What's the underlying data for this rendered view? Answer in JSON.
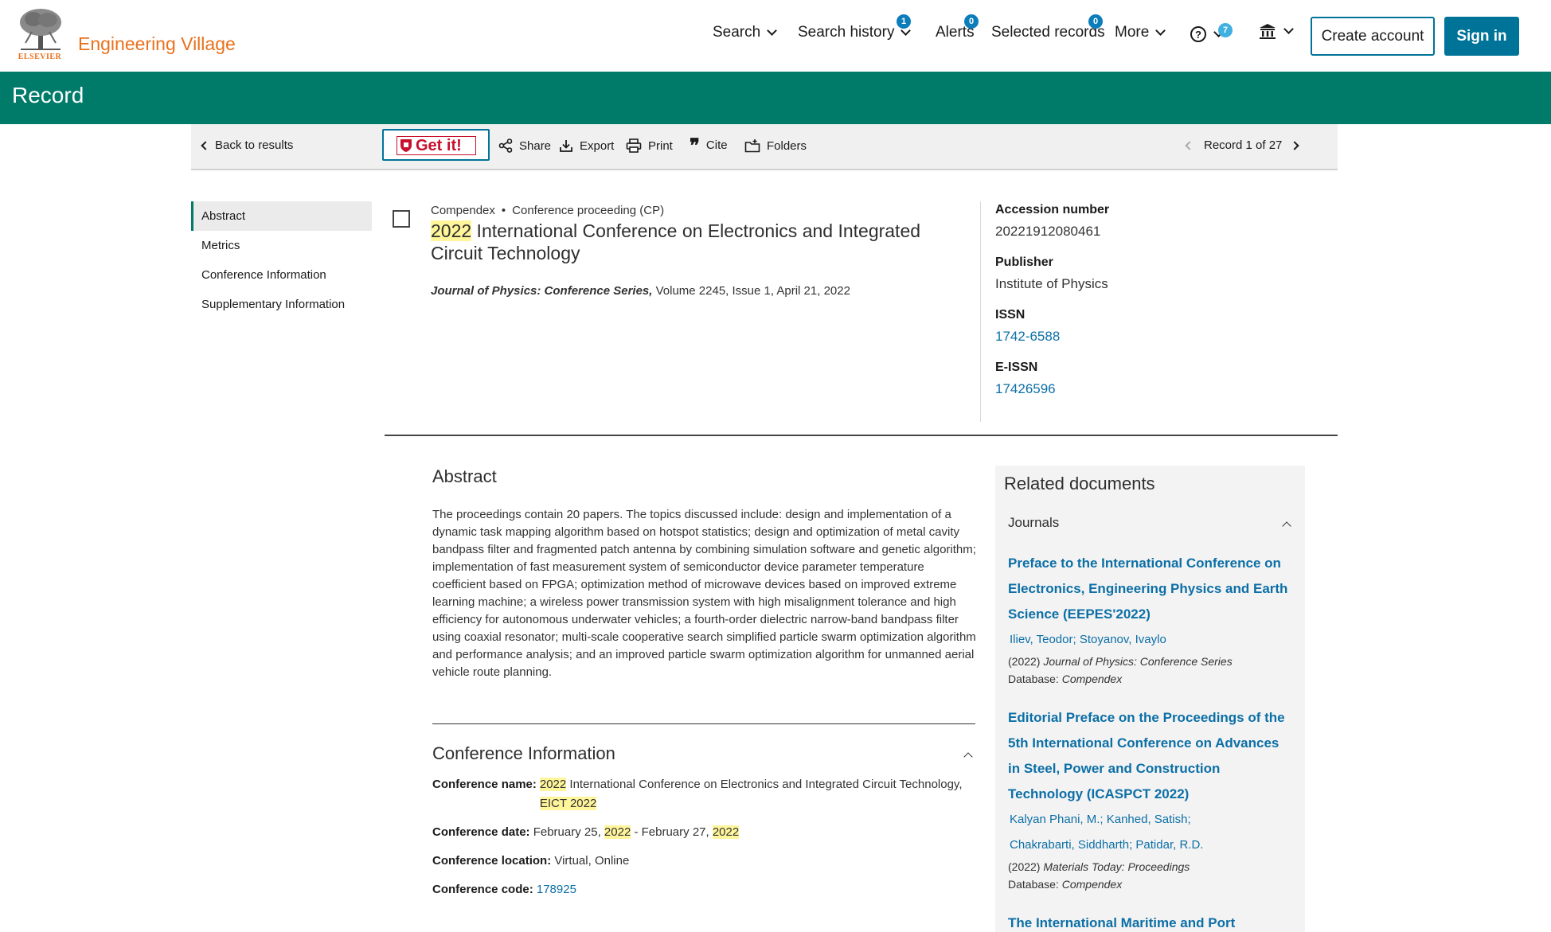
{
  "header": {
    "logo_text": "ELSEVIER",
    "brand": "Engineering Village",
    "nav": {
      "search": "Search",
      "search_history": "Search history",
      "search_history_count": "1",
      "alerts": "Alerts",
      "alerts_count": "0",
      "selected_records": "Selected records",
      "selected_records_count": "0",
      "more": "More",
      "help_count": "7"
    },
    "create_account": "Create account",
    "sign_in": "Sign in",
    "icons": [
      "help-icon",
      "institution-icon",
      "chevron-down-icon"
    ]
  },
  "band": {
    "title": "Record"
  },
  "toolbar": {
    "back": "Back to results",
    "getit": "Get it!",
    "share": "Share",
    "export": "Export",
    "print": "Print",
    "cite": "Cite",
    "folders": "Folders",
    "record_position": "Record 1 of 27"
  },
  "leftnav": {
    "items": [
      "Abstract",
      "Metrics",
      "Conference Information",
      "Supplementary Information"
    ],
    "active": "Abstract"
  },
  "record": {
    "database": "Compendex",
    "bullet": "•",
    "doc_type": "Conference proceeding (CP)",
    "title_year": "2022",
    "title_rest": " International Conference on Electronics and Integrated Circuit Technology",
    "source_journal": "Journal of Physics: Conference Series,",
    "source_rest": " Volume 2245, Issue 1, April 21, 2022"
  },
  "side_meta": {
    "accession_label": "Accession number",
    "accession_value": "20221912080461",
    "publisher_label": "Publisher",
    "publisher_value": "Institute of Physics",
    "issn_label": "ISSN",
    "issn_value": "1742-6588",
    "eissn_label": "E-ISSN",
    "eissn_value": "17426596"
  },
  "abstract": {
    "heading": "Abstract",
    "text": "The proceedings contain 20 papers. The topics discussed include: design and implementation of a dynamic task mapping algorithm based on hotspot statistics; design and optimization of metal cavity bandpass filter and fragmented patch antenna by combining simulation software and genetic algorithm; implementation of fast measurement system of semiconductor device parameter temperature coefficient based on FPGA; optimization method of microwave devices based on improved extreme learning machine; a wireless power transmission system with high misalignment tolerance and high efficiency for autonomous underwater vehicles; a fourth-order dielectric narrow-band bandpass filter using coaxial resonator; multi-scale cooperative search simplified particle swarm optimization algorithm and performance analysis; and an improved particle swarm optimization algorithm for unmanned aerial vehicle route planning."
  },
  "conference": {
    "heading": "Conference Information",
    "name_label": "Conference name:",
    "name_year": "2022",
    "name_rest": " International Conference on Electronics and Integrated Circuit Technology,",
    "name_acronym": "EICT 2022",
    "date_label": "Conference date:",
    "date_start": "February 25, ",
    "date_start_year": "2022",
    "date_sep": " - February 27, ",
    "date_end_year": "2022",
    "location_label": "Conference location:",
    "location_value": "Virtual, Online",
    "code_label": "Conference code:",
    "code_value": "178925"
  },
  "related": {
    "heading": "Related documents",
    "section": "Journals",
    "items": [
      {
        "title": "Preface to the International Conference on Electronics, Engineering Physics and Earth Science (EEPES'2022)",
        "authors": [
          "Iliev, Teodor;",
          "Stoyanov, Ivaylo"
        ],
        "year": "(2022) ",
        "journal": "Journal of Physics: Conference Series",
        "db_label": "Database: ",
        "db": "Compendex"
      },
      {
        "title": "Editorial Preface on the Proceedings of the 5th International Conference on Advances in Steel, Power and Construction Technology (ICASPCT 2022)",
        "authors": [
          "Kalyan Phani, M.;",
          "Kanhed, Satish;",
          "Chakrabarti, Siddharth;",
          "Patidar, R.D."
        ],
        "year": "(2022) ",
        "journal": "Materials Today: Proceedings",
        "db_label": "Database: ",
        "db": "Compendex"
      },
      {
        "title": "The International Maritime and Port"
      }
    ]
  }
}
